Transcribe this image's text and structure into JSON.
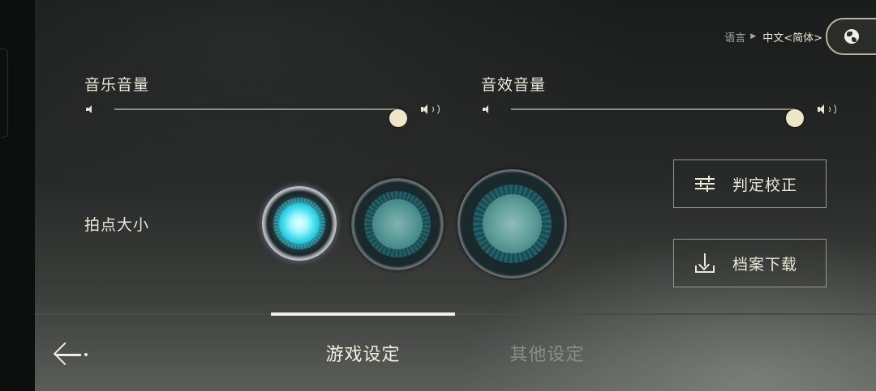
{
  "language": {
    "label": "语言",
    "value": "中文<简体>",
    "icon": "globe-icon"
  },
  "music_volume": {
    "label": "音乐音量",
    "level": 1.0
  },
  "sfx_volume": {
    "label": "音效音量",
    "level": 1.0
  },
  "note_size": {
    "label": "拍点大小",
    "options": [
      "small",
      "medium",
      "large"
    ],
    "selected": "small"
  },
  "buttons": {
    "calibration": "判定校正",
    "download": "档案下载"
  },
  "tabs": [
    {
      "label": "游戏设定",
      "active": true
    },
    {
      "label": "其他设定",
      "active": false
    }
  ],
  "colors": {
    "accent": "#efe6c9",
    "active_note": "#34d6ea"
  }
}
